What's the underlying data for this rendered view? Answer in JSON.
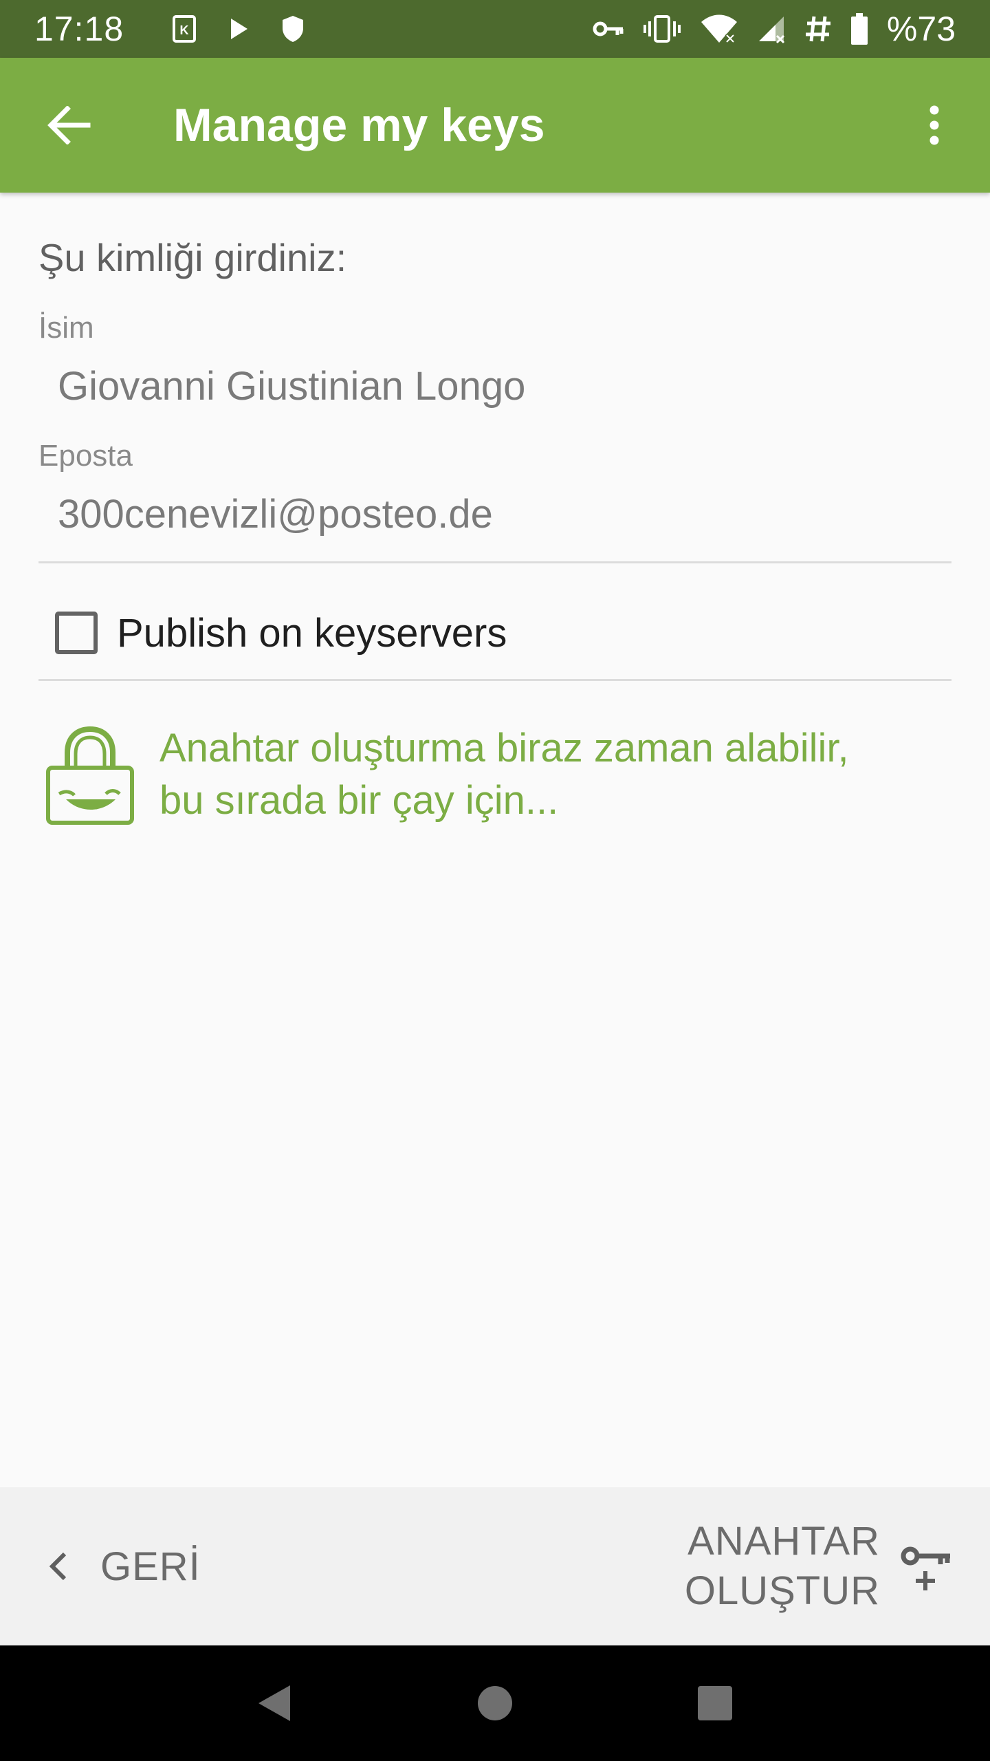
{
  "status_bar": {
    "time": "17:18",
    "battery": "%73",
    "left_icons": [
      "k-notification-icon",
      "play-icon",
      "shield-icon"
    ],
    "right_icons": [
      "vpn-key-icon",
      "vibrate-icon",
      "wifi-icon",
      "signal-icon",
      "hash-icon",
      "battery-icon"
    ]
  },
  "app_bar": {
    "title": "Manage my keys"
  },
  "form": {
    "heading": "Şu kimliği girdiniz:",
    "name_label": "İsim",
    "name_value": "Giovanni Giustinian Longo",
    "email_label": "Eposta",
    "email_value": "300cenevizli@posteo.de",
    "publish_label": "Publish on keyservers",
    "publish_checked": false
  },
  "info": {
    "line1": "Anahtar oluşturma biraz zaman alabilir,",
    "line2": "bu sırada bir çay için..."
  },
  "bottom_bar": {
    "back_label": "GERİ",
    "create_line1": "ANAHTAR",
    "create_line2": "OLUŞTUR"
  },
  "colors": {
    "status_bar": "#4d6a2e",
    "app_bar": "#7cad44",
    "accent": "#7cad44"
  }
}
